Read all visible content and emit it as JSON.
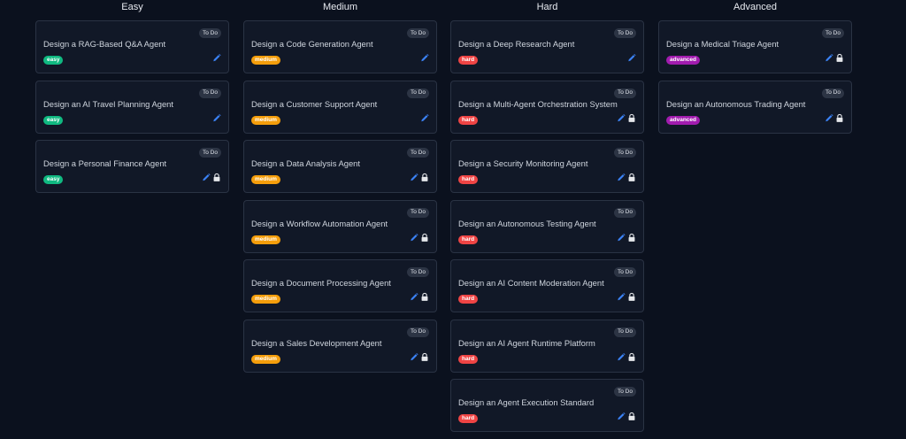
{
  "colors": {
    "background": "#0b111e",
    "card": "#111827",
    "easy": "#10b981",
    "medium": "#f59e0b",
    "hard": "#ef4444",
    "advanced": "#a21caf",
    "edit_icon": "#3b82f6"
  },
  "columns": [
    {
      "title": "Easy",
      "cards": [
        {
          "title": "Design a RAG-Based Q&A Agent",
          "status": "To Do",
          "difficulty": "easy",
          "locked": false
        },
        {
          "title": "Design an AI Travel Planning Agent",
          "status": "To Do",
          "difficulty": "easy",
          "locked": false
        },
        {
          "title": "Design a Personal Finance Agent",
          "status": "To Do",
          "difficulty": "easy",
          "locked": true
        }
      ]
    },
    {
      "title": "Medium",
      "cards": [
        {
          "title": "Design a Code Generation Agent",
          "status": "To Do",
          "difficulty": "medium",
          "locked": false
        },
        {
          "title": "Design a Customer Support Agent",
          "status": "To Do",
          "difficulty": "medium",
          "locked": false
        },
        {
          "title": "Design a Data Analysis Agent",
          "status": "To Do",
          "difficulty": "medium",
          "locked": true
        },
        {
          "title": "Design a Workflow Automation Agent",
          "status": "To Do",
          "difficulty": "medium",
          "locked": true
        },
        {
          "title": "Design a Document Processing Agent",
          "status": "To Do",
          "difficulty": "medium",
          "locked": true
        },
        {
          "title": "Design a Sales Development Agent",
          "status": "To Do",
          "difficulty": "medium",
          "locked": true
        }
      ]
    },
    {
      "title": "Hard",
      "cards": [
        {
          "title": "Design a Deep Research Agent",
          "status": "To Do",
          "difficulty": "hard",
          "locked": false
        },
        {
          "title": "Design a Multi-Agent Orchestration System",
          "status": "To Do",
          "difficulty": "hard",
          "locked": true
        },
        {
          "title": "Design a Security Monitoring Agent",
          "status": "To Do",
          "difficulty": "hard",
          "locked": true
        },
        {
          "title": "Design an Autonomous Testing Agent",
          "status": "To Do",
          "difficulty": "hard",
          "locked": true
        },
        {
          "title": "Design an AI Content Moderation Agent",
          "status": "To Do",
          "difficulty": "hard",
          "locked": true
        },
        {
          "title": "Design an AI Agent Runtime Platform",
          "status": "To Do",
          "difficulty": "hard",
          "locked": true
        },
        {
          "title": "Design an Agent Execution Standard",
          "status": "To Do",
          "difficulty": "hard",
          "locked": true
        }
      ]
    },
    {
      "title": "Advanced",
      "cards": [
        {
          "title": "Design a Medical Triage Agent",
          "status": "To Do",
          "difficulty": "advanced",
          "locked": true
        },
        {
          "title": "Design an Autonomous Trading Agent",
          "status": "To Do",
          "difficulty": "advanced",
          "locked": true
        }
      ]
    }
  ]
}
